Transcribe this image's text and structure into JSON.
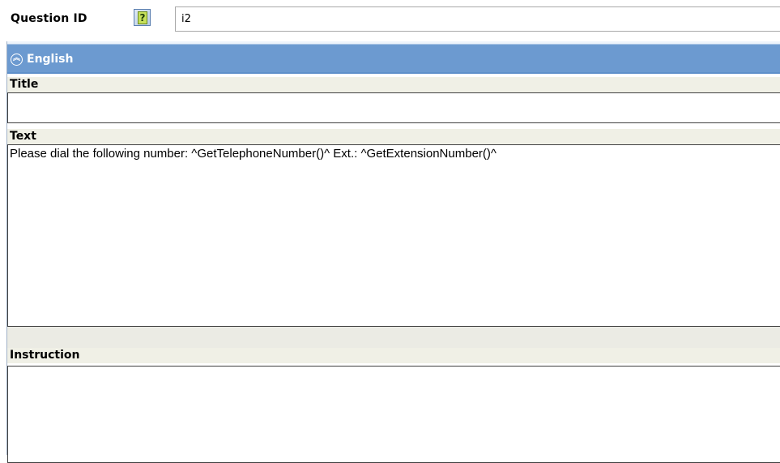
{
  "question_id": {
    "label": "Question ID",
    "help_icon": "help-question-icon",
    "value": "i2"
  },
  "language_panel": {
    "title": "English",
    "collapse_icon": "collapse-up-icon",
    "fields": {
      "title": {
        "label": "Title",
        "value": ""
      },
      "text": {
        "label": "Text",
        "value": "Please dial the following number: ^GetTelephoneNumber()^ Ext.: ^GetExtensionNumber()^"
      },
      "instruction": {
        "label": "Instruction",
        "value": ""
      }
    }
  },
  "colors": {
    "header_blue": "#6c9ad0",
    "label_background": "#f0f0e6"
  }
}
